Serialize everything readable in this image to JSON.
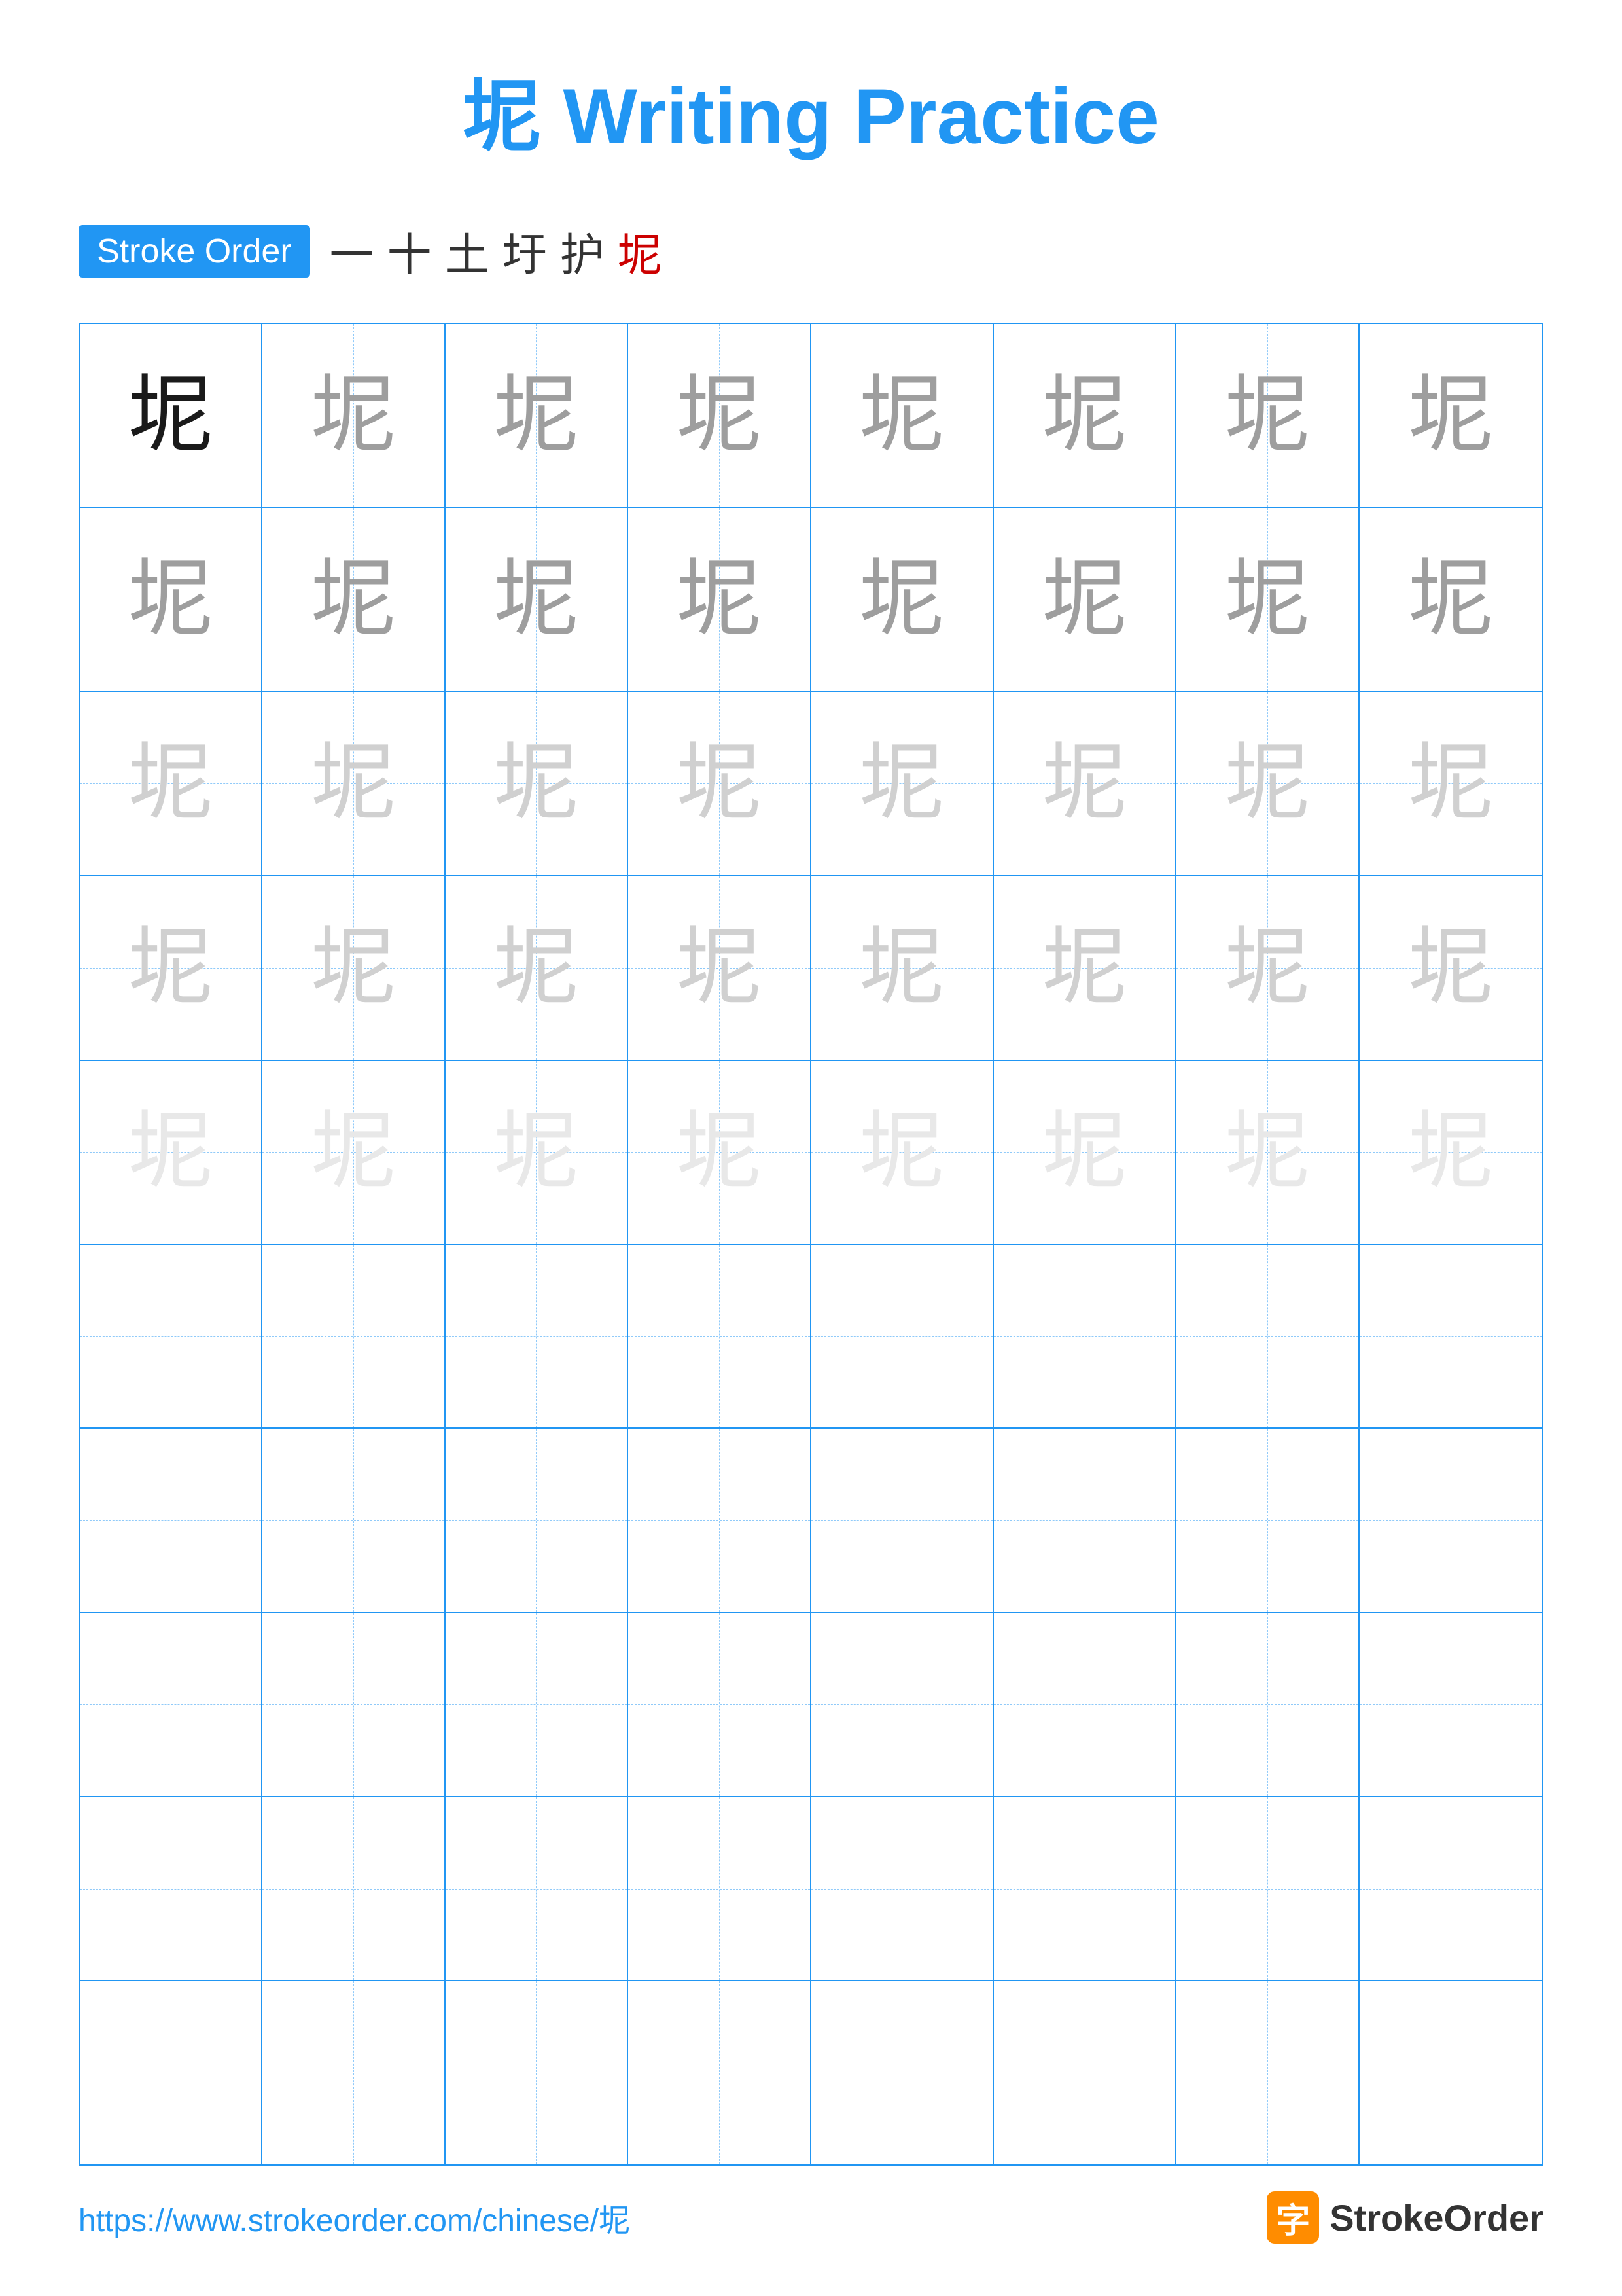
{
  "title": "坭 Writing Practice",
  "stroke_order": {
    "label": "Stroke Order",
    "steps": [
      "一",
      "+",
      "土",
      "圩",
      "护",
      "坭"
    ]
  },
  "character": "坭",
  "grid": {
    "rows": 10,
    "cols": 8,
    "practice_rows": [
      {
        "chars": [
          "dark",
          "medium",
          "medium",
          "medium",
          "medium",
          "medium",
          "medium",
          "medium"
        ]
      },
      {
        "chars": [
          "medium",
          "medium",
          "medium",
          "medium",
          "medium",
          "medium",
          "medium",
          "medium"
        ]
      },
      {
        "chars": [
          "light",
          "light",
          "light",
          "light",
          "light",
          "light",
          "light",
          "light"
        ]
      },
      {
        "chars": [
          "light",
          "light",
          "light",
          "light",
          "light",
          "light",
          "light",
          "light"
        ]
      },
      {
        "chars": [
          "very-light",
          "very-light",
          "very-light",
          "very-light",
          "very-light",
          "very-light",
          "very-light",
          "very-light"
        ]
      },
      {
        "chars": [
          "empty",
          "empty",
          "empty",
          "empty",
          "empty",
          "empty",
          "empty",
          "empty"
        ]
      },
      {
        "chars": [
          "empty",
          "empty",
          "empty",
          "empty",
          "empty",
          "empty",
          "empty",
          "empty"
        ]
      },
      {
        "chars": [
          "empty",
          "empty",
          "empty",
          "empty",
          "empty",
          "empty",
          "empty",
          "empty"
        ]
      },
      {
        "chars": [
          "empty",
          "empty",
          "empty",
          "empty",
          "empty",
          "empty",
          "empty",
          "empty"
        ]
      },
      {
        "chars": [
          "empty",
          "empty",
          "empty",
          "empty",
          "empty",
          "empty",
          "empty",
          "empty"
        ]
      }
    ]
  },
  "footer": {
    "url": "https://www.strokeorder.com/chinese/坭",
    "brand_char": "字",
    "brand_name": "StrokeOrder"
  }
}
